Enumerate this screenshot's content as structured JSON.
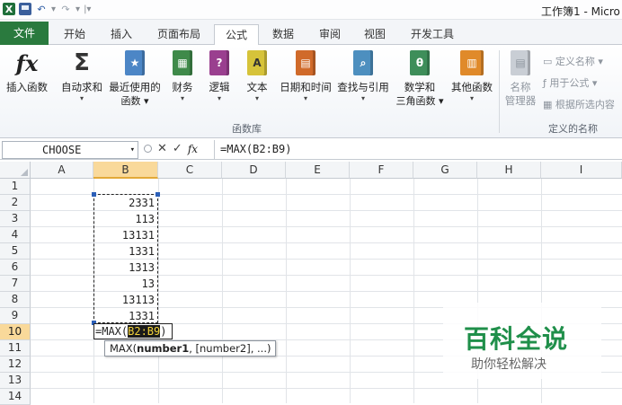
{
  "window": {
    "title": "工作簿1 - Micro"
  },
  "tabs": [
    {
      "label": "文件"
    },
    {
      "label": "开始"
    },
    {
      "label": "插入"
    },
    {
      "label": "页面布局"
    },
    {
      "label": "公式"
    },
    {
      "label": "数据"
    },
    {
      "label": "审阅"
    },
    {
      "label": "视图"
    },
    {
      "label": "开发工具"
    }
  ],
  "ribbon": {
    "insert_function": "插入函数",
    "autosum": "自动求和",
    "recent_line1": "最近使用的",
    "recent_line2": "函数",
    "financial": "财务",
    "logical": "逻辑",
    "text": "文本",
    "datetime": "日期和时间",
    "lookup": "查找与引用",
    "math_line1": "数学和",
    "math_line2": "三角函数",
    "other": "其他函数",
    "name_mgr_line1": "名称",
    "name_mgr_line2": "管理器",
    "define_name": "定义名称",
    "use_in_formula": "用于公式",
    "create_from_sel": "根据所选内容",
    "group_library": "函数库",
    "group_names": "定义的名称",
    "icon_labels": {
      "logical": "?",
      "text": "A",
      "math": "θ"
    }
  },
  "formula_bar": {
    "name_box": "CHOOSE",
    "formula": "=MAX(B2:B9)"
  },
  "grid": {
    "columns": [
      "A",
      "B",
      "C",
      "D",
      "E",
      "F",
      "G",
      "H",
      "I"
    ],
    "rows": [
      "1",
      "2",
      "3",
      "4",
      "5",
      "6",
      "7",
      "8",
      "9",
      "10",
      "11",
      "12",
      "13",
      "14"
    ],
    "b_values": [
      "2331",
      "113",
      "13131",
      "1331",
      "1313",
      "13",
      "13113",
      "1331"
    ],
    "edit_prefix": "=MAX(",
    "edit_ref": "B2:B9",
    "edit_suffix": ")",
    "tooltip_fn": "MAX(",
    "tooltip_arg1": "number1",
    "tooltip_rest": ", [number2], ...)"
  },
  "watermark": {
    "title": "百科全说",
    "subtitle": "助你轻松解决"
  }
}
